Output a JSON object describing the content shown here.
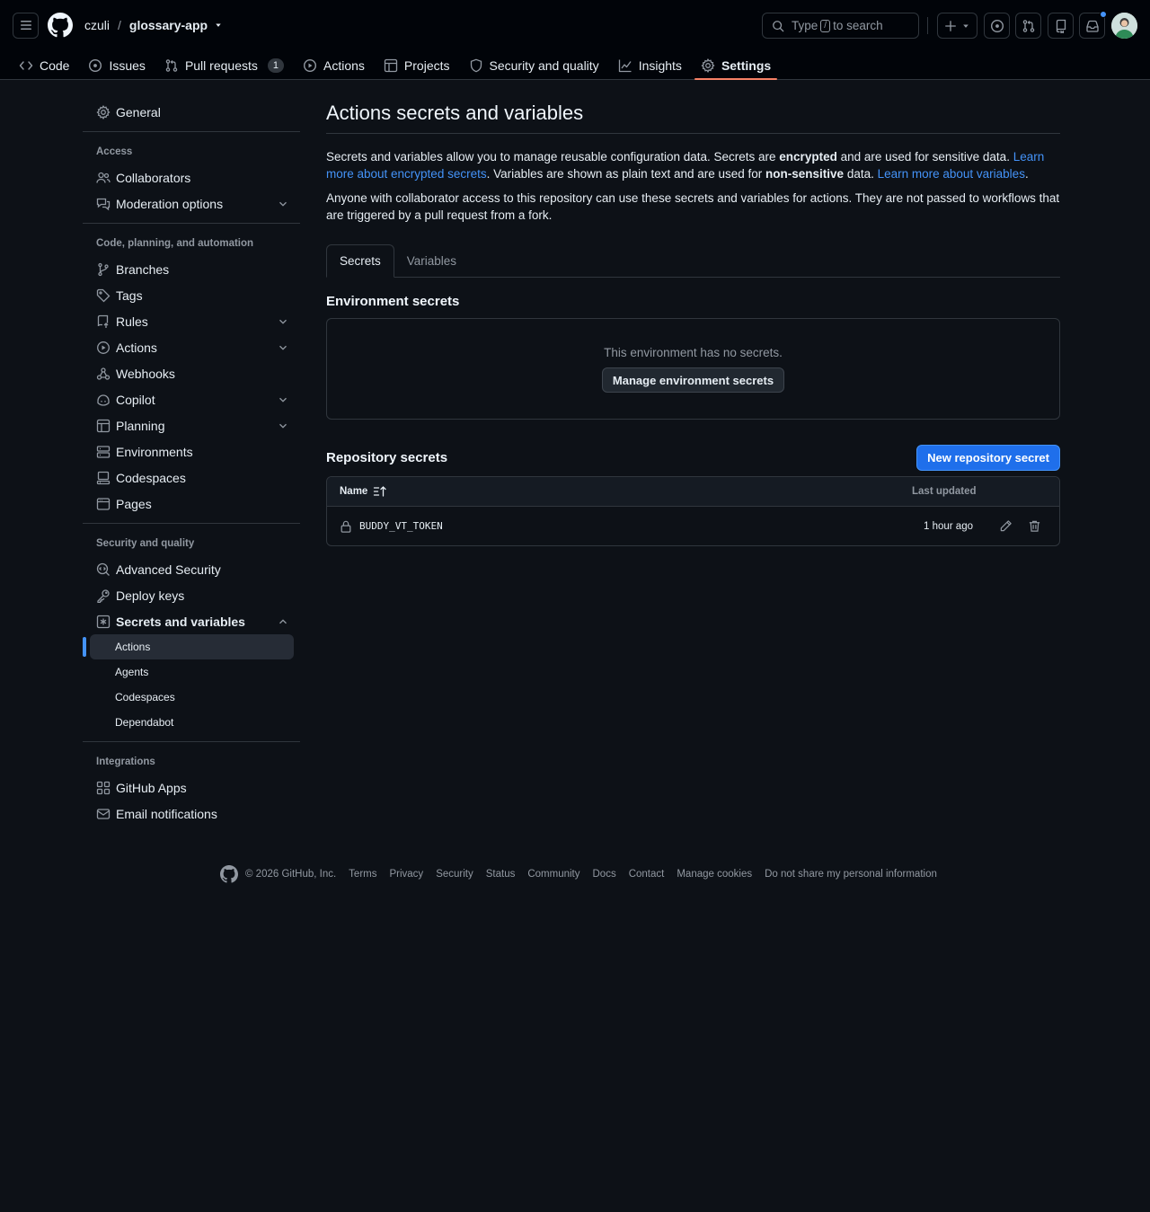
{
  "header": {
    "owner": "czuli",
    "separator": "/",
    "repo": "glossary-app",
    "search_prefix": "Type",
    "search_key": "/",
    "search_suffix": "to search"
  },
  "repo_nav": [
    {
      "label": "Code",
      "icon": "code-icon"
    },
    {
      "label": "Issues",
      "icon": "issue-icon"
    },
    {
      "label": "Pull requests",
      "icon": "pull-request-icon",
      "count": "1"
    },
    {
      "label": "Actions",
      "icon": "play-icon"
    },
    {
      "label": "Projects",
      "icon": "table-icon"
    },
    {
      "label": "Security and quality",
      "icon": "shield-icon"
    },
    {
      "label": "Insights",
      "icon": "graph-icon"
    },
    {
      "label": "Settings",
      "icon": "gear-icon",
      "selected": true
    }
  ],
  "sidebar": {
    "general": "General",
    "access_heading": "Access",
    "access": [
      "Collaborators",
      "Moderation options"
    ],
    "code_heading": "Code, planning, and automation",
    "code": [
      "Branches",
      "Tags",
      "Rules",
      "Actions",
      "Webhooks",
      "Copilot",
      "Planning",
      "Environments",
      "Codespaces",
      "Pages"
    ],
    "security_heading": "Security and quality",
    "security": [
      "Advanced Security",
      "Deploy keys",
      "Secrets and variables"
    ],
    "secrets_sub": [
      "Actions",
      "Agents",
      "Codespaces",
      "Dependabot"
    ],
    "integrations_heading": "Integrations",
    "integrations": [
      "GitHub Apps",
      "Email notifications"
    ]
  },
  "main": {
    "title": "Actions secrets and variables",
    "desc1_a": "Secrets and variables allow you to manage reusable configuration data. Secrets are ",
    "desc1_b": "encrypted",
    "desc1_c": " and are used for sensitive data. ",
    "desc1_link1": "Learn more about encrypted secrets",
    "desc1_d": ". Variables are shown as plain text and are used for ",
    "desc1_e": "non-sensitive",
    "desc1_f": " data. ",
    "desc1_link2": "Learn more about variables",
    "desc1_g": ".",
    "desc2": "Anyone with collaborator access to this repository can use these secrets and variables for actions. They are not passed to workflows that are triggered by a pull request from a fork.",
    "tabs": [
      "Secrets",
      "Variables"
    ],
    "env_title": "Environment secrets",
    "env_empty": "This environment has no secrets.",
    "env_button": "Manage environment secrets",
    "repo_title": "Repository secrets",
    "new_button": "New repository secret",
    "col_name": "Name",
    "col_updated": "Last updated",
    "secrets": [
      {
        "name": "BUDDY_VT_TOKEN",
        "updated": "1 hour ago"
      }
    ]
  },
  "footer": {
    "copyright": "© 2026 GitHub, Inc.",
    "links": [
      "Terms",
      "Privacy",
      "Security",
      "Status",
      "Community",
      "Docs",
      "Contact",
      "Manage cookies",
      "Do not share my personal information"
    ]
  },
  "colors": {
    "background": "#0d1117",
    "header": "#010409",
    "accent": "#1f6feb",
    "link": "#4493f8",
    "selected_tab_underline": "#f78166"
  }
}
